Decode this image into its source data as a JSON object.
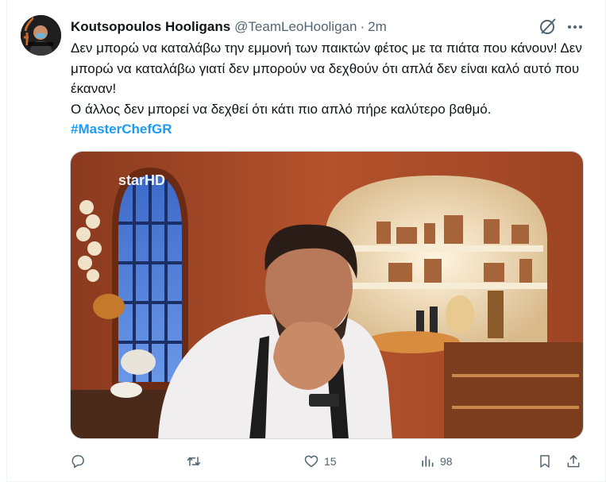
{
  "tweet": {
    "display_name": "Koutsopoulos Hooligans",
    "handle": "@TeamLeoHooligan",
    "separator": "·",
    "time": "2m",
    "text_line_1": "Δεν μπορώ να καταλάβω την εμμονή των παικτών φέτος με τα πιάτα που κάνουν! Δεν μπορώ να καταλάβω γιατί δεν μπορούν να δεχθούν ότι απλά δεν είναι καλό αυτό που έκαναν!",
    "text_line_2": "Ο άλλος δεν μπορεί να δεχθεί ότι κάτι πιο απλό πήρε καλύτερο βαθμό.",
    "hashtag": "#MasterChefGR",
    "media_watermark": "starHD"
  },
  "actions": {
    "reply_count": "",
    "retweet_count": "",
    "like_count": "15",
    "views_count": "98"
  },
  "icons": {
    "grok": "grok-icon",
    "more": "more-icon",
    "reply": "reply-icon",
    "retweet": "retweet-icon",
    "like": "heart-icon",
    "views": "views-icon",
    "bookmark": "bookmark-icon",
    "share": "share-icon"
  },
  "colors": {
    "text": "#0f1419",
    "secondary": "#536471",
    "link": "#1d9bf0"
  }
}
